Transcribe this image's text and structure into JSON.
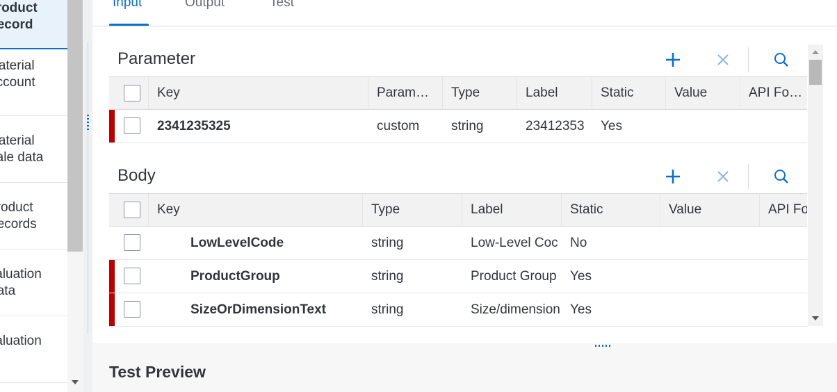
{
  "left_nav": {
    "items": [
      {
        "lines": [
          "Product",
          "Record"
        ],
        "selected": true
      },
      {
        "lines": [
          "Material",
          "Account"
        ],
        "selected": false
      },
      {
        "lines": [
          "Material",
          "Sale data"
        ],
        "selected": false
      },
      {
        "lines": [
          "Product",
          "Records"
        ],
        "selected": false
      },
      {
        "lines": [
          "Valuation",
          "Data"
        ],
        "selected": false
      },
      {
        "lines": [
          "Valuation",
          ""
        ],
        "selected": false
      }
    ]
  },
  "tabs": [
    {
      "label": "Input",
      "active": true
    },
    {
      "label": "Output",
      "active": false
    },
    {
      "label": "Test",
      "active": false
    }
  ],
  "parameter_section": {
    "title": "Parameter",
    "columns": [
      "Key",
      "Param…",
      "Type",
      "Label",
      "Static",
      "Value",
      "API Fo…"
    ],
    "rows": [
      {
        "key": "2341235325",
        "param": "custom",
        "type": "string",
        "label": "23412353",
        "static": "Yes",
        "value": "",
        "api": "",
        "error": true
      }
    ]
  },
  "body_section": {
    "title": "Body",
    "columns": [
      "Key",
      "Type",
      "Label",
      "Static",
      "Value",
      "API Fo"
    ],
    "rows": [
      {
        "key": "LowLevelCode",
        "type": "string",
        "label": "Low-Level Coc",
        "static": "No",
        "value": "",
        "api": "",
        "error": false
      },
      {
        "key": "ProductGroup",
        "type": "string",
        "label": "Product Group",
        "static": "Yes",
        "value": "",
        "api": "",
        "error": true
      },
      {
        "key": "SizeOrDimensionText",
        "type": "string",
        "label": "Size/dimension",
        "static": "Yes",
        "value": "",
        "api": "",
        "error": true
      }
    ]
  },
  "preview": {
    "title": "Test Preview"
  },
  "colors": {
    "accent": "#0a6ed1",
    "error": "#bb0000",
    "header_bg": "#f2f2f2"
  },
  "icons": {
    "add": "plus-icon",
    "delete": "close-icon",
    "search": "search-icon"
  }
}
